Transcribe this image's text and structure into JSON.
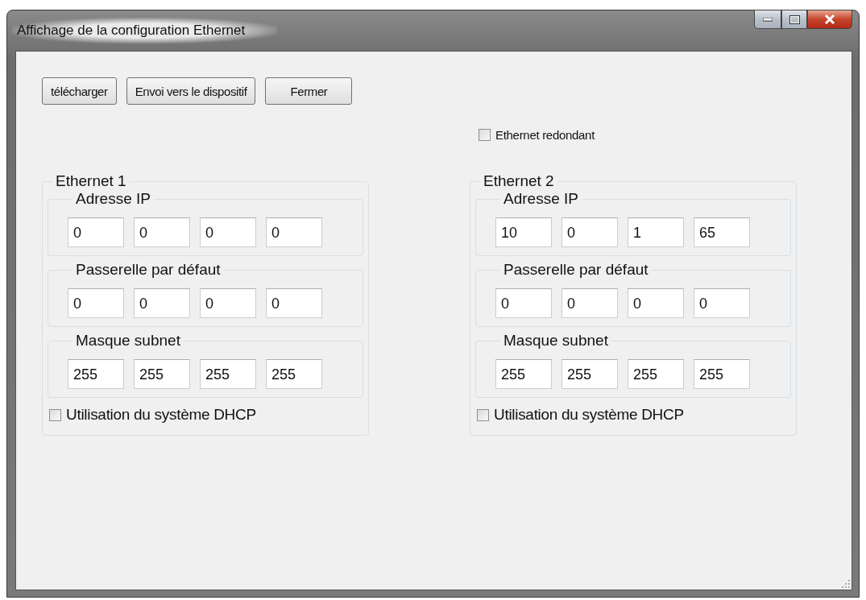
{
  "window": {
    "title": "Affichage de la configuration Ethernet"
  },
  "buttons": [
    {
      "label": "télécharger"
    },
    {
      "label": "Envoi vers le dispositif"
    },
    {
      "label": "Fermer"
    }
  ],
  "redundant": {
    "label": "Ethernet redondant",
    "checked": false
  },
  "ethernets": [
    {
      "title": "Ethernet 1",
      "sections": [
        {
          "title": "Adresse IP",
          "octets": [
            "0",
            "0",
            "0",
            "0"
          ]
        },
        {
          "title": "Passerelle par défaut",
          "octets": [
            "0",
            "0",
            "0",
            "0"
          ]
        },
        {
          "title": "Masque subnet",
          "octets": [
            "255",
            "255",
            "255",
            "255"
          ]
        }
      ],
      "dhcp": {
        "label": "Utilisation du système DHCP",
        "checked": false
      }
    },
    {
      "title": "Ethernet 2",
      "sections": [
        {
          "title": "Adresse IP",
          "octets": [
            "10",
            "0",
            "1",
            "65"
          ]
        },
        {
          "title": "Passerelle par défaut",
          "octets": [
            "0",
            "0",
            "0",
            "0"
          ]
        },
        {
          "title": "Masque subnet",
          "octets": [
            "255",
            "255",
            "255",
            "255"
          ]
        }
      ],
      "dhcp": {
        "label": "Utilisation du système DHCP",
        "checked": false
      }
    }
  ]
}
